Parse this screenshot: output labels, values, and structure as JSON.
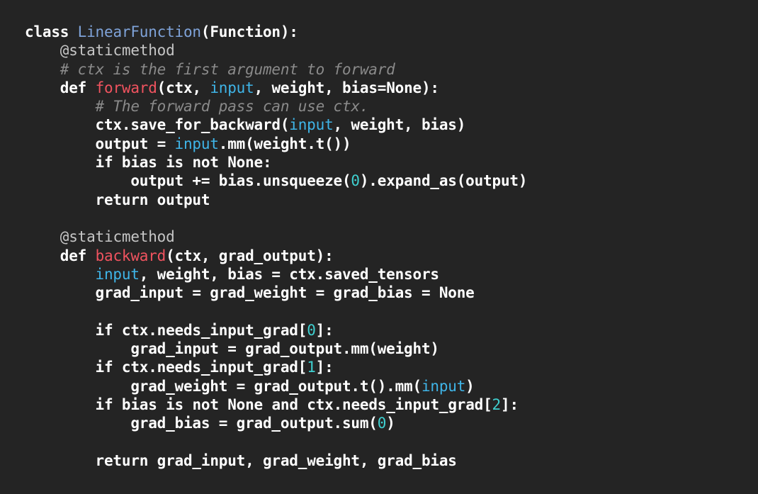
{
  "colors": {
    "background": "#242424",
    "text": "#ffffff",
    "class_name": "#7fa3d9",
    "decorator": "#c6c6c6",
    "comment": "#8a8a8a",
    "function_name": "#f0535f",
    "builtin": "#3fb5e8",
    "number": "#3fd0d0"
  },
  "lines": [
    [
      {
        "t": "kw",
        "v": "class "
      },
      {
        "t": "cls",
        "v": "LinearFunction"
      },
      {
        "t": "tx",
        "v": "(Function):"
      }
    ],
    [
      {
        "t": "tx",
        "v": "    "
      },
      {
        "t": "deco",
        "v": "@staticmethod"
      }
    ],
    [
      {
        "t": "tx",
        "v": "    "
      },
      {
        "t": "cm",
        "v": "# ctx is the first argument to forward"
      }
    ],
    [
      {
        "t": "tx",
        "v": "    "
      },
      {
        "t": "kw",
        "v": "def "
      },
      {
        "t": "fn",
        "v": "forward"
      },
      {
        "t": "tx",
        "v": "(ctx, "
      },
      {
        "t": "bi",
        "v": "input"
      },
      {
        "t": "tx",
        "v": ", weight, bias=None):"
      }
    ],
    [
      {
        "t": "tx",
        "v": "        "
      },
      {
        "t": "cm",
        "v": "# The forward pass can use ctx."
      }
    ],
    [
      {
        "t": "tx",
        "v": "        ctx.save_for_backward("
      },
      {
        "t": "bi",
        "v": "input"
      },
      {
        "t": "tx",
        "v": ", weight, bias)"
      }
    ],
    [
      {
        "t": "tx",
        "v": "        output = "
      },
      {
        "t": "bi",
        "v": "input"
      },
      {
        "t": "tx",
        "v": ".mm(weight.t())"
      }
    ],
    [
      {
        "t": "tx",
        "v": "        "
      },
      {
        "t": "kw",
        "v": "if"
      },
      {
        "t": "tx",
        "v": " bias "
      },
      {
        "t": "kw",
        "v": "is not"
      },
      {
        "t": "tx",
        "v": " None:"
      }
    ],
    [
      {
        "t": "tx",
        "v": "            output += bias.unsqueeze("
      },
      {
        "t": "num",
        "v": "0"
      },
      {
        "t": "tx",
        "v": ").expand_as(output)"
      }
    ],
    [
      {
        "t": "tx",
        "v": "        "
      },
      {
        "t": "kw",
        "v": "return"
      },
      {
        "t": "tx",
        "v": " output"
      }
    ],
    [],
    [
      {
        "t": "tx",
        "v": "    "
      },
      {
        "t": "deco",
        "v": "@staticmethod"
      }
    ],
    [
      {
        "t": "tx",
        "v": "    "
      },
      {
        "t": "kw",
        "v": "def "
      },
      {
        "t": "fn",
        "v": "backward"
      },
      {
        "t": "tx",
        "v": "(ctx, grad_output):"
      }
    ],
    [
      {
        "t": "tx",
        "v": "        "
      },
      {
        "t": "bi",
        "v": "input"
      },
      {
        "t": "tx",
        "v": ", weight, bias = ctx.saved_tensors"
      }
    ],
    [
      {
        "t": "tx",
        "v": "        grad_input = grad_weight = grad_bias = None"
      }
    ],
    [],
    [
      {
        "t": "tx",
        "v": "        "
      },
      {
        "t": "kw",
        "v": "if"
      },
      {
        "t": "tx",
        "v": " ctx.needs_input_grad["
      },
      {
        "t": "num",
        "v": "0"
      },
      {
        "t": "tx",
        "v": "]:"
      }
    ],
    [
      {
        "t": "tx",
        "v": "            grad_input = grad_output.mm(weight)"
      }
    ],
    [
      {
        "t": "tx",
        "v": "        "
      },
      {
        "t": "kw",
        "v": "if"
      },
      {
        "t": "tx",
        "v": " ctx.needs_input_grad["
      },
      {
        "t": "num",
        "v": "1"
      },
      {
        "t": "tx",
        "v": "]:"
      }
    ],
    [
      {
        "t": "tx",
        "v": "            grad_weight = grad_output.t().mm("
      },
      {
        "t": "bi",
        "v": "input"
      },
      {
        "t": "tx",
        "v": ")"
      }
    ],
    [
      {
        "t": "tx",
        "v": "        "
      },
      {
        "t": "kw",
        "v": "if"
      },
      {
        "t": "tx",
        "v": " bias "
      },
      {
        "t": "kw",
        "v": "is not"
      },
      {
        "t": "tx",
        "v": " None "
      },
      {
        "t": "kw",
        "v": "and"
      },
      {
        "t": "tx",
        "v": " ctx.needs_input_grad["
      },
      {
        "t": "num",
        "v": "2"
      },
      {
        "t": "tx",
        "v": "]:"
      }
    ],
    [
      {
        "t": "tx",
        "v": "            grad_bias = grad_output.sum("
      },
      {
        "t": "num",
        "v": "0"
      },
      {
        "t": "tx",
        "v": ")"
      }
    ],
    [],
    [
      {
        "t": "tx",
        "v": "        "
      },
      {
        "t": "kw",
        "v": "return"
      },
      {
        "t": "tx",
        "v": " grad_input, grad_weight, grad_bias"
      }
    ]
  ]
}
